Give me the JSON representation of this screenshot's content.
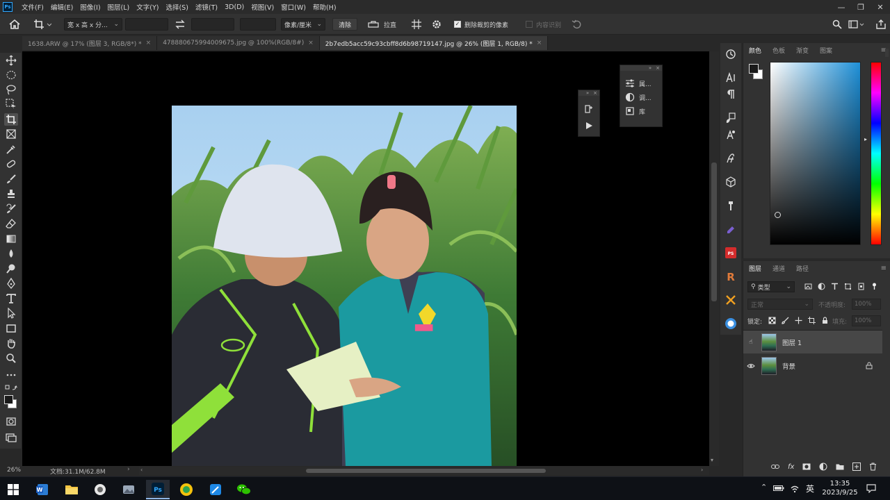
{
  "menubar": {
    "logo": "Ps",
    "items": [
      "文件(F)",
      "编辑(E)",
      "图像(I)",
      "图层(L)",
      "文字(Y)",
      "选择(S)",
      "滤镜(T)",
      "3D(D)",
      "视图(V)",
      "窗口(W)",
      "帮助(H)"
    ],
    "minimize": "—",
    "restore": "❐",
    "close": "✕"
  },
  "options": {
    "ratio_select": "宽 x 高 x 分...",
    "units_select": "像素/厘米",
    "clear_label": "清除",
    "straighten_label": "拉直",
    "delete_cropped_label": "删除裁剪的像素",
    "content_aware_label": "内容识别"
  },
  "tabs": [
    {
      "label": "1638.ARW @ 17% (图层 3, RGB/8*) *",
      "active": false
    },
    {
      "label": "478880675994009675.jpg @ 100%(RGB/8#)",
      "active": false
    },
    {
      "label": "2b7edb5acc59c93cbff8d6b98719147.jpg @ 26% (图层 1, RGB/8) *",
      "active": true
    }
  ],
  "floating_panel": {
    "rows": [
      "属...",
      "调...",
      "库"
    ]
  },
  "status": {
    "zoom": "26%",
    "doc_info": "文档:31.1M/62.8M"
  },
  "color_panel": {
    "tabs": [
      "颜色",
      "色板",
      "渐变",
      "图案"
    ],
    "hue_colors": [
      "#ff0000",
      "#ff00ff",
      "#0000ff",
      "#00ffff",
      "#00ff00",
      "#ffff00",
      "#ff0000"
    ],
    "selected_hue": "#1e90d8"
  },
  "layers_panel": {
    "tabs": [
      "图层",
      "通道",
      "路径"
    ],
    "filter_kind": "类型",
    "blend_mode": "正常",
    "opacity_label": "不透明度:",
    "opacity_value": "100%",
    "lock_label": "锁定:",
    "fill_label": "填充:",
    "fill_value": "100%",
    "layers": [
      {
        "name": "图层 1",
        "selected": true,
        "locked": false
      },
      {
        "name": "背景",
        "selected": false,
        "locked": true
      }
    ]
  },
  "taskbar": {
    "time": "13:35",
    "date": "2023/9/25",
    "ime": "英"
  },
  "colors": {
    "accent": "#31a8ff",
    "panel": "#323232",
    "taskbar": "#0e1116"
  }
}
